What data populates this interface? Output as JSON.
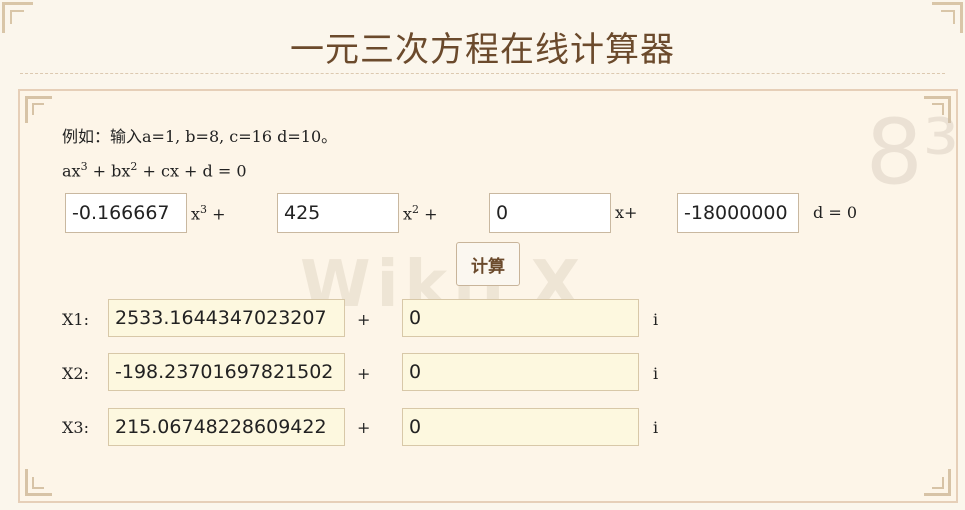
{
  "title": "一元三次方程在线计算器",
  "example": "例如：输入a=1, b=8, c=16 d=10。",
  "formula": {
    "ax": "ax",
    "plus_bx": " + bx",
    "plus_cx_d": " + cx + d = 0",
    "exp3": "3",
    "exp2": "2"
  },
  "inputs": {
    "a": "-0.166667",
    "b": "425",
    "c": "0",
    "d": "-18000000",
    "x3_label": "x",
    "x3_exp": "3",
    "x3_tail": " +",
    "x2_label": "x",
    "x2_exp": "2",
    "x2_tail": " +",
    "x_label": "x+",
    "d_label": "d = 0"
  },
  "calc_button": "计算",
  "results": [
    {
      "label": "X1:",
      "real": "2533.1644347023207",
      "plus": "+",
      "imag": "0",
      "i": "i"
    },
    {
      "label": "X2:",
      "real": "-198.23701697821502",
      "plus": "+",
      "imag": "0",
      "i": "i"
    },
    {
      "label": "X3:",
      "real": "215.06748228609422",
      "plus": "+",
      "imag": "0",
      "i": "i"
    }
  ],
  "watermark": "WikiFX"
}
